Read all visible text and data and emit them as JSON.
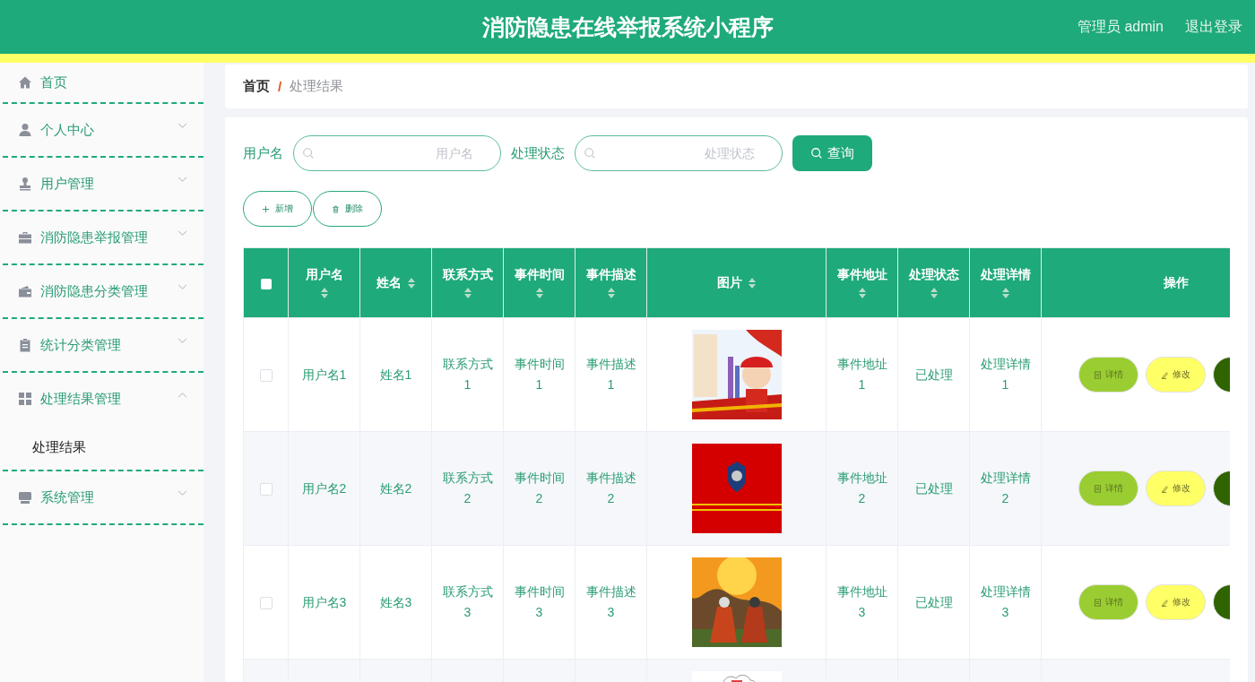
{
  "header": {
    "title": "消防隐患在线举报系统小程序",
    "user": "管理员 admin",
    "logout": "退出登录"
  },
  "sidebar": {
    "items": [
      {
        "label": "首页"
      },
      {
        "label": "个人中心",
        "expanded": false
      },
      {
        "label": "用户管理",
        "expanded": false
      },
      {
        "label": "消防隐患举报管理",
        "expanded": false
      },
      {
        "label": "消防隐患分类管理",
        "expanded": false
      },
      {
        "label": "统计分类管理",
        "expanded": false
      },
      {
        "label": "处理结果管理",
        "expanded": true,
        "children": [
          {
            "label": "处理结果",
            "selected": true
          }
        ]
      },
      {
        "label": "系统管理",
        "expanded": false
      }
    ]
  },
  "breadcrumb": {
    "items": [
      "首页",
      "处理结果"
    ],
    "separator": "/"
  },
  "search": {
    "fields": [
      {
        "label": "用户名",
        "placeholder": "用户名"
      },
      {
        "label": "处理状态",
        "placeholder": "处理状态"
      }
    ],
    "button": "查询"
  },
  "toolbar": [
    "新增",
    "删除"
  ],
  "table": {
    "select_all": {
      "checked": false
    },
    "columns": [
      {
        "label": "用户名",
        "sortable": true
      },
      {
        "label": "姓名",
        "sortable": true
      },
      {
        "label": "联系方式",
        "sortable": true
      },
      {
        "label": "事件时间",
        "sortable": true
      },
      {
        "label": "事件描述",
        "sortable": true
      },
      {
        "label": "图片",
        "sortable": true
      },
      {
        "label": "事件地址",
        "sortable": true
      },
      {
        "label": "处理状态",
        "sortable": true
      },
      {
        "label": "处理详情",
        "sortable": true
      },
      {
        "label": "操作",
        "sortable": false
      }
    ],
    "rows": [
      {
        "checked": false,
        "cells": [
          {
            "kind": "text",
            "text": "用户名1"
          },
          {
            "kind": "text",
            "text": "姓名1"
          },
          {
            "kind": "text",
            "text": "联系方式1"
          },
          {
            "kind": "text",
            "text": "事件时间1"
          },
          {
            "kind": "text",
            "text": "事件描述1"
          },
          {
            "kind": "picture"
          },
          {
            "kind": "text",
            "text": "事件地址1"
          },
          {
            "kind": "text",
            "text": "已处理"
          },
          {
            "kind": "text",
            "text": "处理详情1"
          },
          {
            "kind": "actions",
            "actions": [
              {
                "kind": "detail",
                "label": "详情"
              },
              {
                "kind": "edit",
                "label": "修改"
              },
              {
                "kind": "delete"
              }
            ]
          }
        ]
      },
      {
        "checked": false,
        "cells": [
          {
            "kind": "text",
            "text": "用户名2"
          },
          {
            "kind": "text",
            "text": "姓名2"
          },
          {
            "kind": "text",
            "text": "联系方式2"
          },
          {
            "kind": "text",
            "text": "事件时间2"
          },
          {
            "kind": "text",
            "text": "事件描述2"
          },
          {
            "kind": "picture"
          },
          {
            "kind": "text",
            "text": "事件地址2"
          },
          {
            "kind": "text",
            "text": "已处理"
          },
          {
            "kind": "text",
            "text": "处理详情2"
          },
          {
            "kind": "actions",
            "actions": [
              {
                "kind": "detail",
                "label": "详情"
              },
              {
                "kind": "edit",
                "label": "修改"
              },
              {
                "kind": "delete"
              }
            ]
          }
        ]
      },
      {
        "checked": false,
        "cells": [
          {
            "kind": "text",
            "text": "用户名3"
          },
          {
            "kind": "text",
            "text": "姓名3"
          },
          {
            "kind": "text",
            "text": "联系方式3"
          },
          {
            "kind": "text",
            "text": "事件时间3"
          },
          {
            "kind": "text",
            "text": "事件描述3"
          },
          {
            "kind": "picture"
          },
          {
            "kind": "text",
            "text": "事件地址3"
          },
          {
            "kind": "text",
            "text": "已处理"
          },
          {
            "kind": "text",
            "text": "处理详情3"
          },
          {
            "kind": "actions",
            "actions": [
              {
                "kind": "detail",
                "label": "详情"
              },
              {
                "kind": "edit",
                "label": "修改"
              },
              {
                "kind": "delete"
              }
            ]
          }
        ]
      },
      {
        "cells": [
          {
            "kind": "blank"
          },
          {
            "kind": "blank"
          },
          {
            "kind": "blank"
          },
          {
            "kind": "blank"
          },
          {
            "kind": "blank"
          },
          {
            "kind": "picture"
          },
          {
            "kind": "blank"
          },
          {
            "kind": "blank"
          },
          {
            "kind": "blank"
          },
          {
            "kind": "blank"
          }
        ]
      }
    ]
  }
}
